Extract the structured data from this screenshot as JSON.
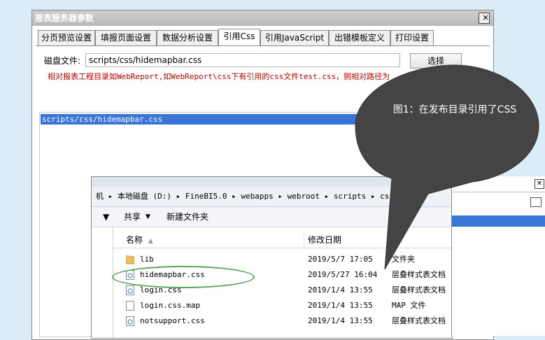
{
  "dialog": {
    "title": "报表服务器参数",
    "close": "✕",
    "tabs": [
      "分页预览设置",
      "填报页面设置",
      "数据分析设置",
      "引用Css",
      "引用JavaScript",
      "出错模板定义",
      "打印设置"
    ],
    "active_tab": "引用Css",
    "file_label": "磁盘文件:",
    "file_value": "scripts/css/hidemapbar.css",
    "choose_button": "选择",
    "hint": "相对报表工程目录如WebReport,如WebReport\\css下有引用的css文件test.css，则相对路径为",
    "list_item": "scripts/css/hidemapbar.css"
  },
  "explorer": {
    "address_parts": [
      "机",
      "本地磁盘 (D:)",
      "FineBI5.0",
      "webapps",
      "webroot",
      "scripts",
      "css"
    ],
    "toolbar": {
      "share": "共享",
      "new_folder": "新建文件夹"
    },
    "columns": {
      "name": "名称",
      "date": "修改日期",
      "type": ""
    },
    "rows": [
      {
        "name": "lib",
        "date": "2019/5/7 17:05",
        "type": "文件夹",
        "icon": "folder-icon"
      },
      {
        "name": "hidemapbar.css",
        "date": "2019/5/27 16:04",
        "type": "层叠样式表文档",
        "icon": "css-file-icon"
      },
      {
        "name": "login.css",
        "date": "2019/1/4 13:55",
        "type": "层叠样式表文档",
        "icon": "css-file-icon"
      },
      {
        "name": "login.css.map",
        "date": "2019/1/4 13:55",
        "type": "MAP 文件",
        "icon": "file-icon"
      },
      {
        "name": "notsupport.css",
        "date": "2019/1/4 13:55",
        "type": "层叠样式表文档",
        "icon": "css-file-icon"
      }
    ]
  },
  "callout": {
    "text": "图1：在发布目录引用了CSS"
  },
  "colors": {
    "callout_bg": "#444444",
    "selection": "#3875d7",
    "hint": "#c40000",
    "highlight": "#5aa65a"
  }
}
